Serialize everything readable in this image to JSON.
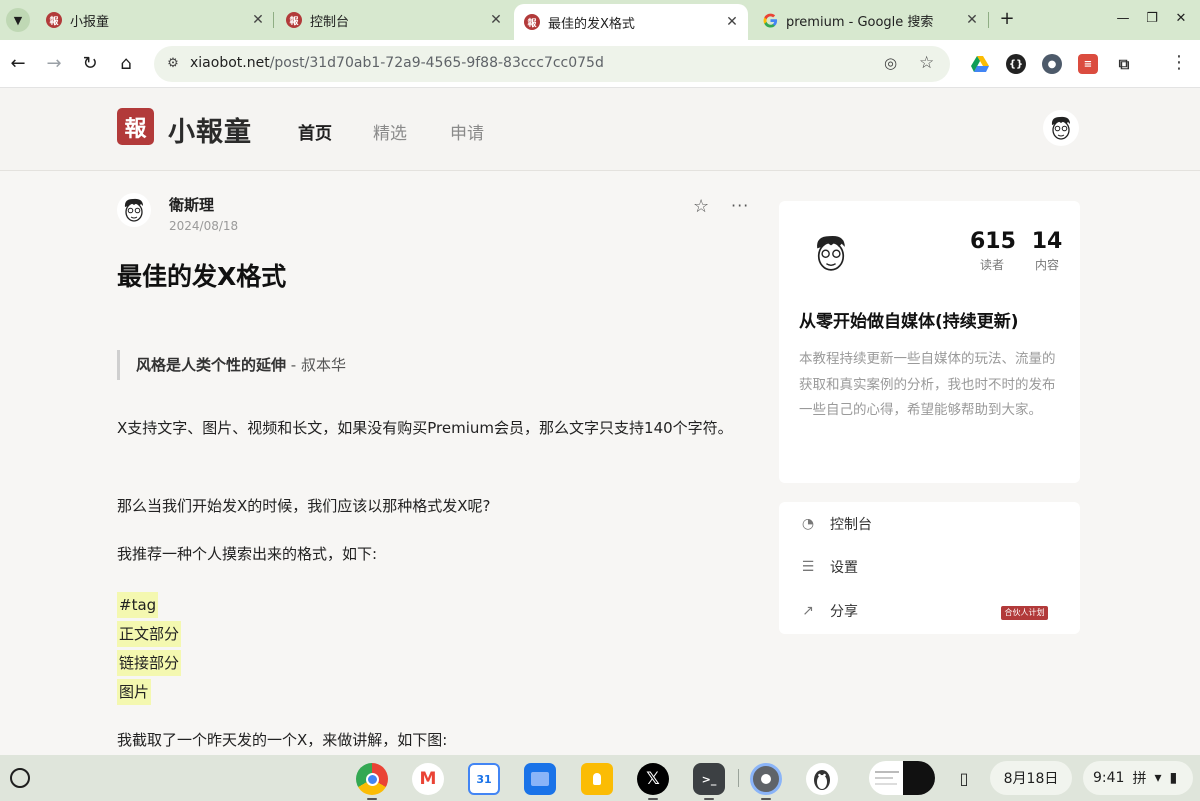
{
  "browser": {
    "tabs": [
      {
        "title": "小报童",
        "favicon": "報",
        "active": false
      },
      {
        "title": "控制台",
        "favicon": "報",
        "active": false
      },
      {
        "title": "最佳的发X格式",
        "favicon": "報",
        "active": true
      },
      {
        "title": "premium - Google 搜索",
        "favicon": "G",
        "active": false
      }
    ],
    "url_host": "xiaobot.net",
    "url_path": "/post/31d70ab1-72a9-4565-9f88-83ccc7cc075d",
    "icons": {
      "tab_search": "chevron-down-icon",
      "new_tab": "plus-icon",
      "back": "arrow-left-icon",
      "forward": "arrow-right-icon",
      "reload": "reload-icon",
      "home": "home-icon",
      "site_info": "tune-icon",
      "tracking": "eye-off-icon",
      "bookmark": "star-icon",
      "extensions": "puzzle-icon",
      "menu": "more-vert-icon"
    },
    "glyphs": {
      "close": "✕",
      "new_tab": "+",
      "minimize": "—",
      "maximize": "❐",
      "window_close": "✕",
      "back": "←",
      "forward": "→",
      "reload": "↻",
      "home": "⌂",
      "site_info": "⚙",
      "tracking": "◎",
      "bookmark": "☆",
      "menu": "⋮"
    }
  },
  "site": {
    "logo_mark": "報",
    "logo_text": "小報童",
    "nav": [
      {
        "label": "首页",
        "active": true
      },
      {
        "label": "精选",
        "active": false
      },
      {
        "label": "申请",
        "active": false
      }
    ],
    "accent_color": "#b23a3a"
  },
  "post": {
    "author": "衛斯理",
    "date": "2024/08/18",
    "title": "最佳的发X格式",
    "quote_bold": "风格是人类个性的延伸",
    "quote_rest": " - 叔本华",
    "paragraphs": [
      "X支持文字、图片、视频和长文，如果没有购买Premium会员，那么文字只支持140个字符。",
      "那么当我们开始发X的时候，我们应该以那种格式发X呢?",
      "我推荐一种个人摸索出来的格式，如下:"
    ],
    "highlights": [
      "#tag",
      "正文部分",
      "链接部分",
      "图片"
    ],
    "after_list": "我截取了一个昨天发的一个X，来做讲解，如下图:",
    "actions": {
      "star": "☆",
      "more": "···"
    },
    "highlight_color": "#f4f8b0"
  },
  "sidebar": {
    "readers_count": "615",
    "readers_label": "读者",
    "content_count": "14",
    "content_label": "内容",
    "column_title": "从零开始做自媒体(持续更新)",
    "column_desc": "本教程持续更新一些自媒体的玩法、流量的获取和真实案例的分析，我也时不时的发布一些自己的心得，希望能够帮助到大家。",
    "menu": [
      {
        "label": "控制台",
        "icon": "dashboard-icon",
        "glyph": "◔"
      },
      {
        "label": "设置",
        "icon": "settings-icon",
        "glyph": "☰"
      },
      {
        "label": "分享",
        "icon": "share-icon",
        "glyph": "↗"
      }
    ],
    "partner_badge": "合伙人计划"
  },
  "shelf": {
    "apps": [
      "chrome-icon",
      "gmail-icon",
      "calendar-icon",
      "files-icon",
      "keep-icon",
      "x-icon",
      "terminal-icon",
      "settings-icon",
      "penguin-icon"
    ],
    "calendar_day": "31",
    "terminal_glyph": ">_",
    "x_glyph": "𝕏",
    "gmail_glyph": "M",
    "date": "8月18日",
    "time": "9:41",
    "ime": "拼",
    "status_icons": {
      "wifi": "▾",
      "battery": "▮"
    }
  }
}
